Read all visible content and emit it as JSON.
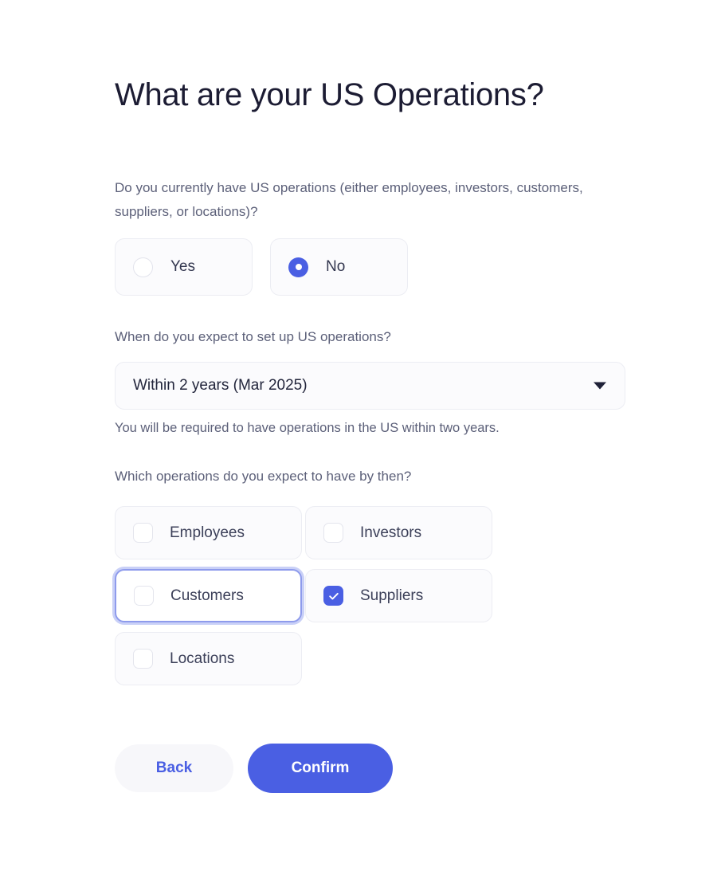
{
  "page": {
    "title": "What are your US Operations?"
  },
  "current_ops": {
    "question": "Do you currently have US operations (either employees, investors, customers, suppliers, or locations)?",
    "options": [
      {
        "label": "Yes",
        "value": "yes",
        "selected": false
      },
      {
        "label": "No",
        "value": "no",
        "selected": true
      }
    ]
  },
  "timeline": {
    "question": "When do you expect to set up US operations?",
    "selected_value": "Within 2 years (Mar 2025)",
    "caret_icon": "chevron-down-icon",
    "helper_text": "You will be required to have operations in the US within two years."
  },
  "expected_ops": {
    "question": "Which operations do you expect to have by then?",
    "options": [
      {
        "label": "Employees",
        "checked": false,
        "focused": false
      },
      {
        "label": "Investors",
        "checked": false,
        "focused": false
      },
      {
        "label": "Customers",
        "checked": false,
        "focused": true
      },
      {
        "label": "Suppliers",
        "checked": true,
        "focused": false
      },
      {
        "label": "Locations",
        "checked": false,
        "focused": false
      }
    ]
  },
  "actions": {
    "back_label": "Back",
    "confirm_label": "Confirm"
  },
  "colors": {
    "accent": "#4a5fe3",
    "title": "#1c1c33",
    "body_text": "#5c6079",
    "card_bg": "#fbfbfd",
    "card_border": "#ecedf3",
    "focus_ring": "#c9d0f7",
    "back_bg": "#f7f7fa"
  }
}
